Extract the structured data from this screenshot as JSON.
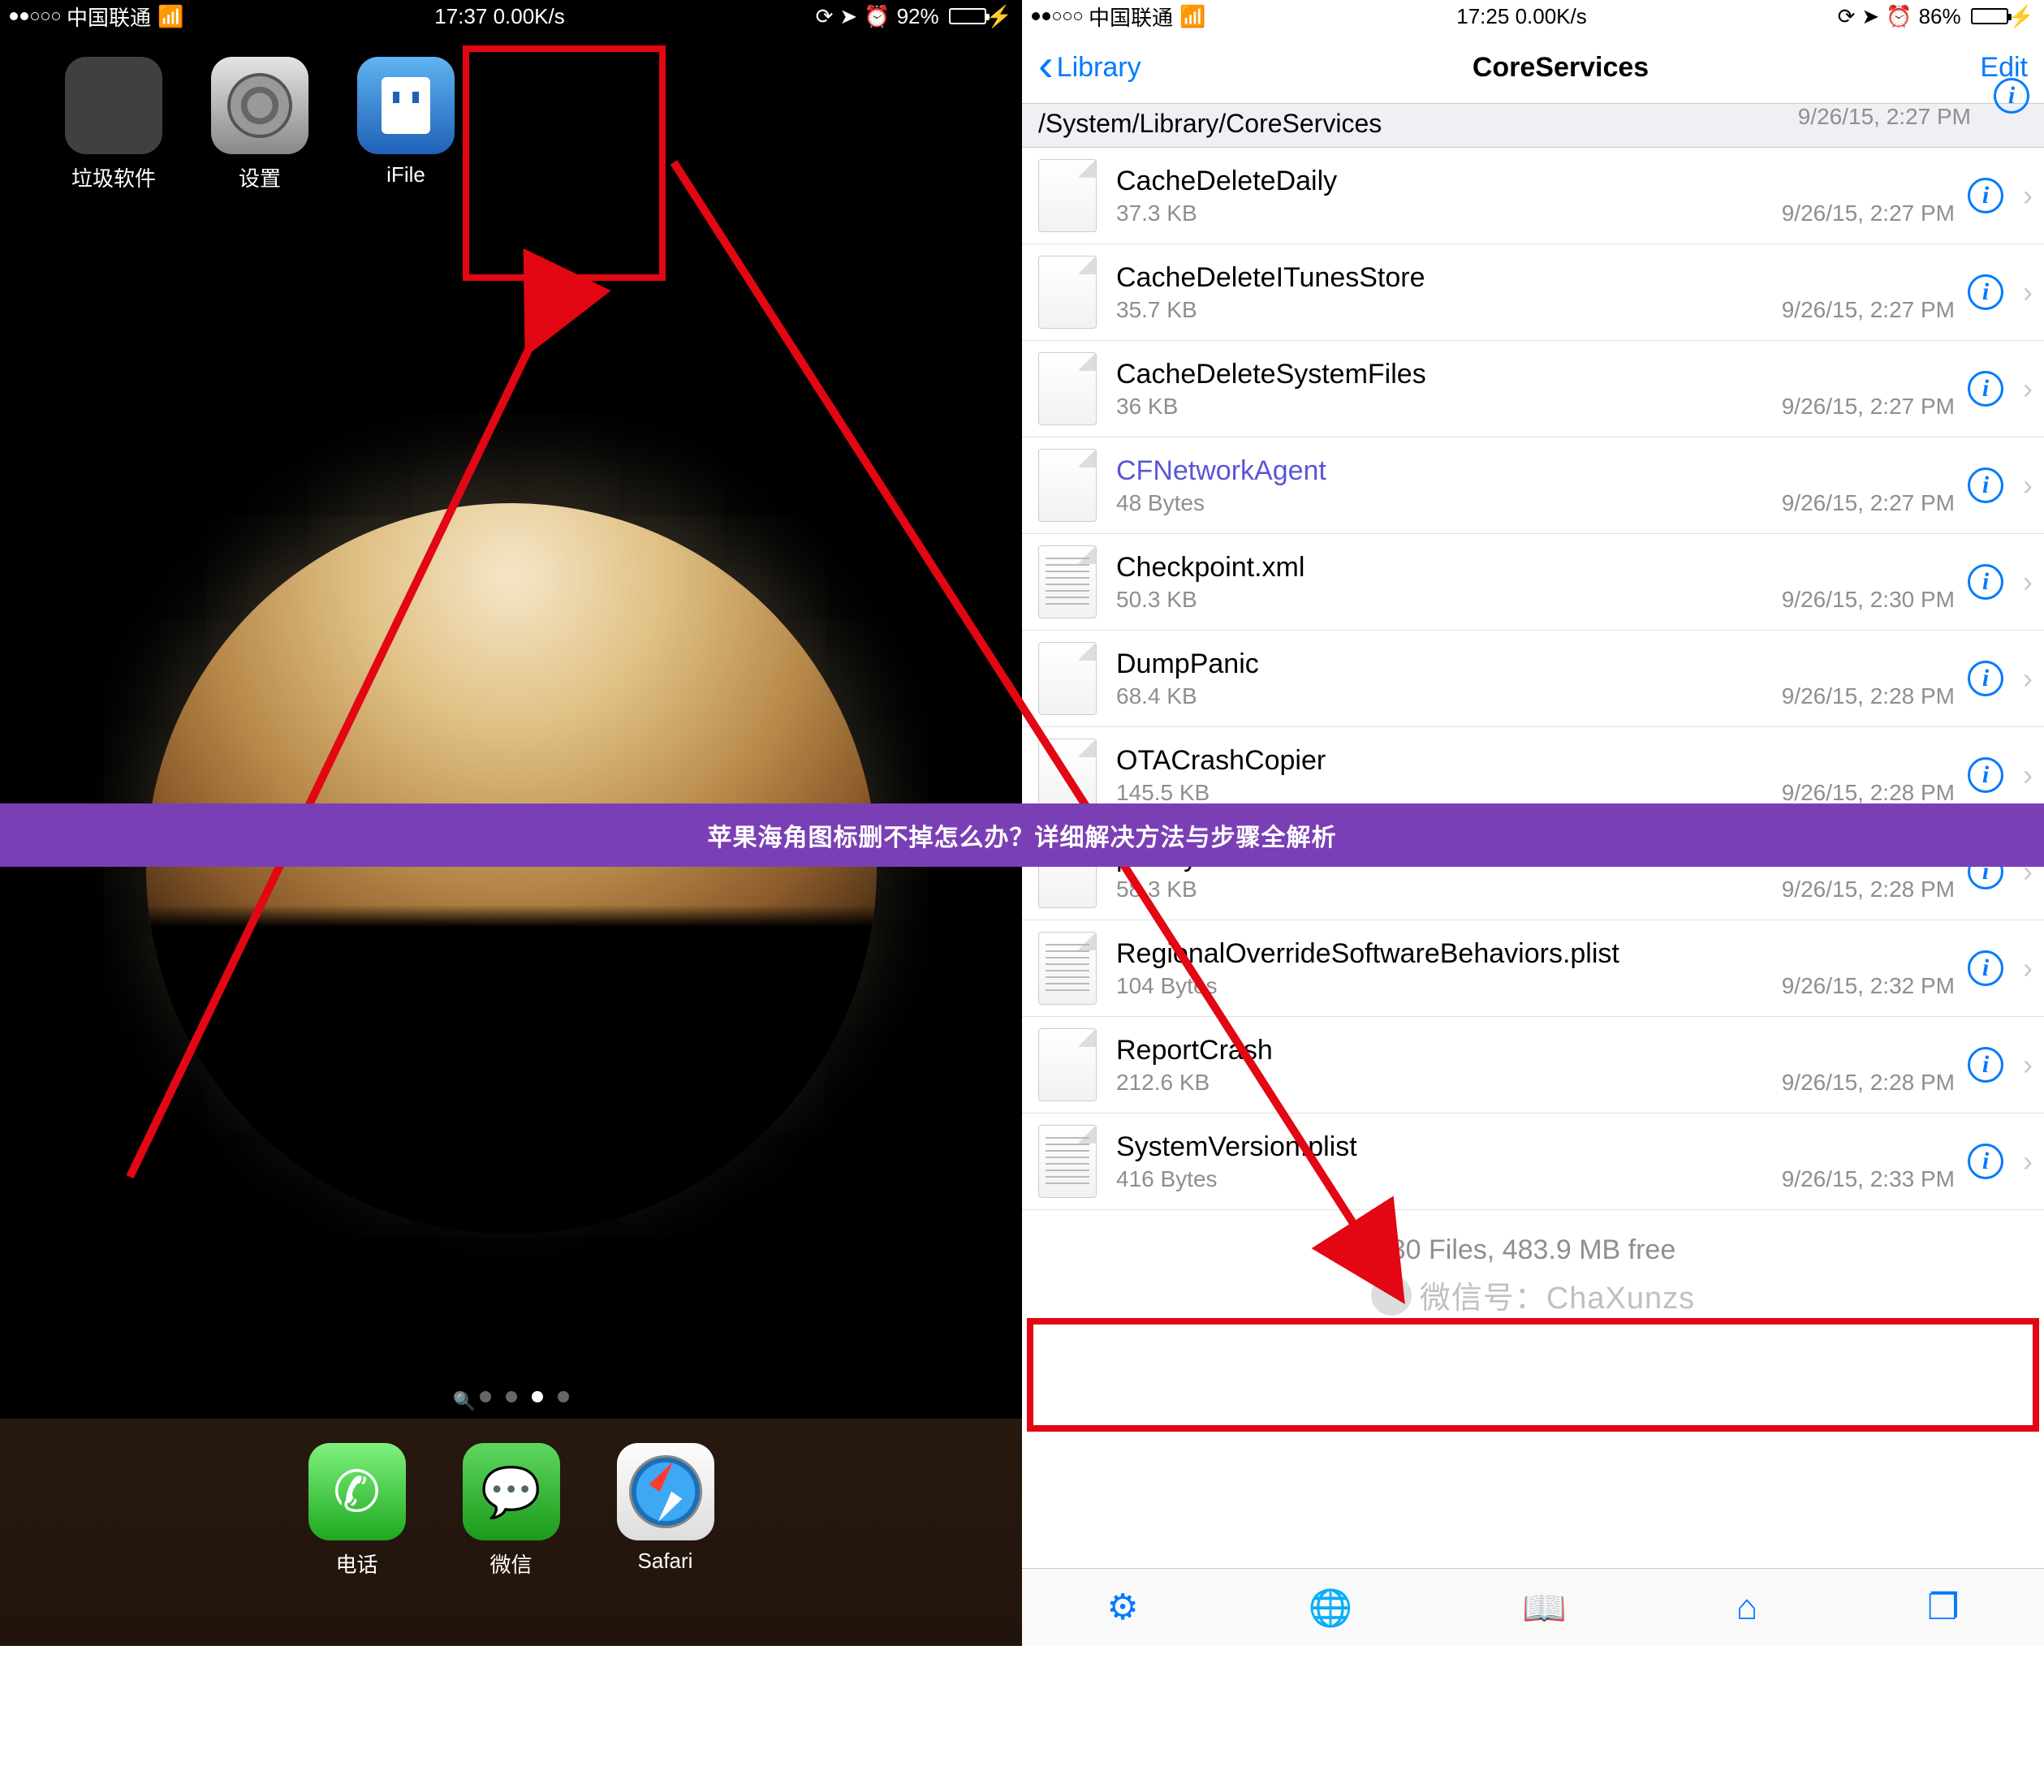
{
  "banner_text": "苹果海角图标删不掉怎么办？详细解决方法与步骤全解析",
  "left": {
    "status": {
      "carrier": "中国联通",
      "time": "17:37",
      "speed": "0.00K/s",
      "battery_pct": "92%",
      "battery_fill": 92
    },
    "apps": {
      "folder_label": "垃圾软件",
      "settings_label": "设置",
      "ifile_label": "iFile"
    },
    "dock": {
      "phone": "电话",
      "wechat": "微信",
      "safari": "Safari"
    }
  },
  "right": {
    "status": {
      "carrier": "中国联通",
      "time": "17:25",
      "speed": "0.00K/s",
      "battery_pct": "86%",
      "battery_fill": 86
    },
    "nav": {
      "back": "Library",
      "title": "CoreServices",
      "edit": "Edit"
    },
    "path": "/System/Library/CoreServices",
    "path_ghost_date": "9/26/15, 2:27 PM",
    "files": [
      {
        "name": "CacheDeleteDaily",
        "size": "37.3 KB",
        "date": "9/26/15, 2:27 PM",
        "type": "bin"
      },
      {
        "name": "CacheDeleteITunesStore",
        "size": "35.7 KB",
        "date": "9/26/15, 2:27 PM",
        "type": "bin"
      },
      {
        "name": "CacheDeleteSystemFiles",
        "size": "36 KB",
        "date": "9/26/15, 2:27 PM",
        "type": "bin"
      },
      {
        "name": "CFNetworkAgent",
        "size": "48 Bytes",
        "date": "9/26/15, 2:27 PM",
        "type": "link"
      },
      {
        "name": "Checkpoint.xml",
        "size": "50.3 KB",
        "date": "9/26/15, 2:30 PM",
        "type": "xml"
      },
      {
        "name": "DumpPanic",
        "size": "68.4 KB",
        "date": "9/26/15, 2:28 PM",
        "type": "bin"
      },
      {
        "name": "OTACrashCopier",
        "size": "145.5 KB",
        "date": "9/26/15, 2:28 PM",
        "type": "bin"
      },
      {
        "name": "prdaily",
        "size": "58.3 KB",
        "date": "9/26/15, 2:28 PM",
        "type": "bin"
      },
      {
        "name": "RegionalOverrideSoftwareBehaviors.plist",
        "size": "104 Bytes",
        "date": "9/26/15, 2:32 PM",
        "type": "plist"
      },
      {
        "name": "ReportCrash",
        "size": "212.6 KB",
        "date": "9/26/15, 2:28 PM",
        "type": "bin"
      },
      {
        "name": "SystemVersion.plist",
        "size": "416 Bytes",
        "date": "9/26/15, 2:33 PM",
        "type": "plist"
      }
    ],
    "footer": "30 Files, 483.9 MB free",
    "watermark": "微信号：ChaXunzs"
  }
}
